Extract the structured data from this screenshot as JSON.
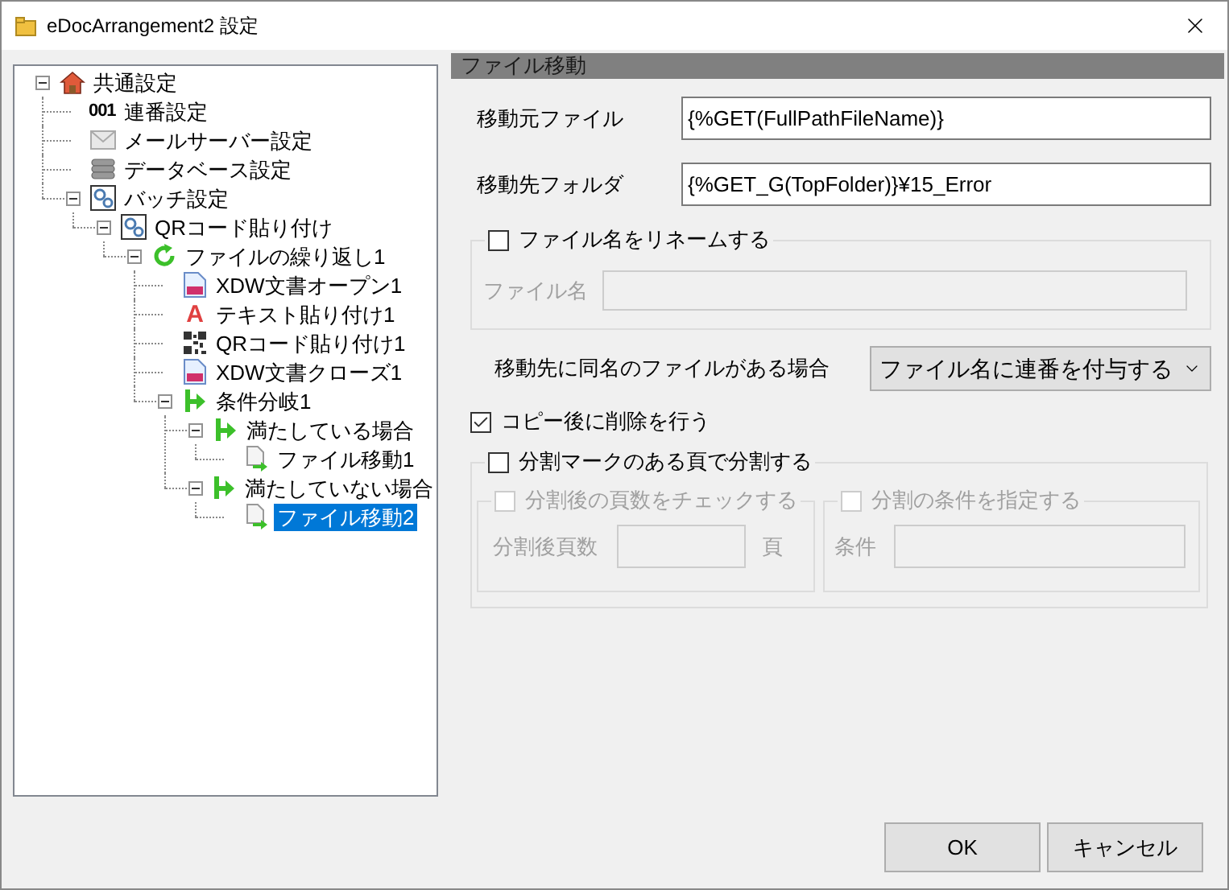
{
  "window": {
    "title": "eDocArrangement2 設定"
  },
  "tree": [
    {
      "label": "共通設定",
      "kind": "house",
      "expanded": true,
      "selected": false,
      "children": [
        {
          "label": "連番設定",
          "kind": "counter",
          "icon_text": "001",
          "selected": false
        },
        {
          "label": "メールサーバー設定",
          "kind": "mail",
          "selected": false
        },
        {
          "label": "データベース設定",
          "kind": "database",
          "selected": false
        },
        {
          "label": "バッチ設定",
          "kind": "gears",
          "expanded": true,
          "selected": false,
          "children": [
            {
              "label": "QRコード貼り付け",
              "kind": "gears",
              "expanded": true,
              "selected": false,
              "children": [
                {
                  "label": "ファイルの繰り返し1",
                  "kind": "loop",
                  "expanded": true,
                  "selected": false,
                  "children": [
                    {
                      "label": "XDW文書オープン1",
                      "kind": "document",
                      "selected": false
                    },
                    {
                      "label": "テキスト貼り付け1",
                      "kind": "letter",
                      "icon_text": "A",
                      "selected": false
                    },
                    {
                      "label": "QRコード貼り付け1",
                      "kind": "qr",
                      "selected": false
                    },
                    {
                      "label": "XDW文書クローズ1",
                      "kind": "document",
                      "selected": false
                    },
                    {
                      "label": "条件分岐1",
                      "kind": "branch",
                      "expanded": true,
                      "selected": false,
                      "children": [
                        {
                          "label": "満たしている場合",
                          "kind": "branch",
                          "expanded": true,
                          "selected": false,
                          "children": [
                            {
                              "label": "ファイル移動1",
                              "kind": "move",
                              "selected": false
                            }
                          ]
                        },
                        {
                          "label": "満たしていない場合",
                          "kind": "branch",
                          "expanded": true,
                          "selected": false,
                          "children": [
                            {
                              "label": "ファイル移動2",
                              "kind": "move",
                              "selected": true
                            }
                          ]
                        }
                      ]
                    }
                  ]
                }
              ]
            }
          ]
        }
      ]
    }
  ],
  "panel": {
    "title": "ファイル移動",
    "source_file": {
      "label": "移動元ファイル",
      "value": "{%GET(FullPathFileName)}"
    },
    "dest_folder": {
      "label": "移動先フォルダ",
      "value": "{%GET_G(TopFolder)}¥15_Error"
    },
    "rename": {
      "label": "ファイル名をリネームする",
      "checked": false,
      "field_label": "ファイル名"
    },
    "conflict": {
      "label": "移動先に同名のファイルがある場合",
      "value": "ファイル名に連番を付与する"
    },
    "delete_after_copy": {
      "label": "コピー後に削除を行う",
      "checked": true
    },
    "split": {
      "label": "分割マークのある頁で分割する",
      "checked": false,
      "page_check": {
        "label": "分割後の頁数をチェックする",
        "checked": false,
        "field_label": "分割後頁数",
        "unit": "頁"
      },
      "condition": {
        "label": "分割の条件を指定する",
        "checked": false,
        "field_label": "条件"
      }
    }
  },
  "buttons": [
    {
      "label": "OK"
    },
    {
      "label": "キャンセル"
    }
  ]
}
